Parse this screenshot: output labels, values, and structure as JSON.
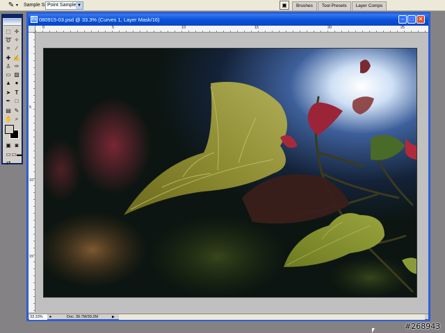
{
  "options_bar": {
    "tool_icon": "eyedropper-icon",
    "sample_size_label": "Sample Size:",
    "sample_size_value": "Point Sample",
    "palette_toggle_icon": "palette-toggle-icon",
    "palette_tabs": [
      "Brushes",
      "Tool Presets",
      "Layer Comps"
    ]
  },
  "document": {
    "title": "080915-03.psd @ 33.3% (Curves 1, Layer Mask/16)",
    "ruler_top_labels": [
      "0",
      "5",
      "10",
      "15",
      "20",
      "25"
    ],
    "ruler_left_labels": [
      "5",
      "10",
      "15"
    ],
    "status": {
      "zoom": "33.33%",
      "doc_size": "Doc: 39.7M/39.2M"
    }
  },
  "colors": {
    "title_bar": "#0a52d8",
    "window_border": "#2c5fd9",
    "workspace": "#848284",
    "canvas_surround": "#c0c0c0"
  },
  "watermark": "#268943"
}
